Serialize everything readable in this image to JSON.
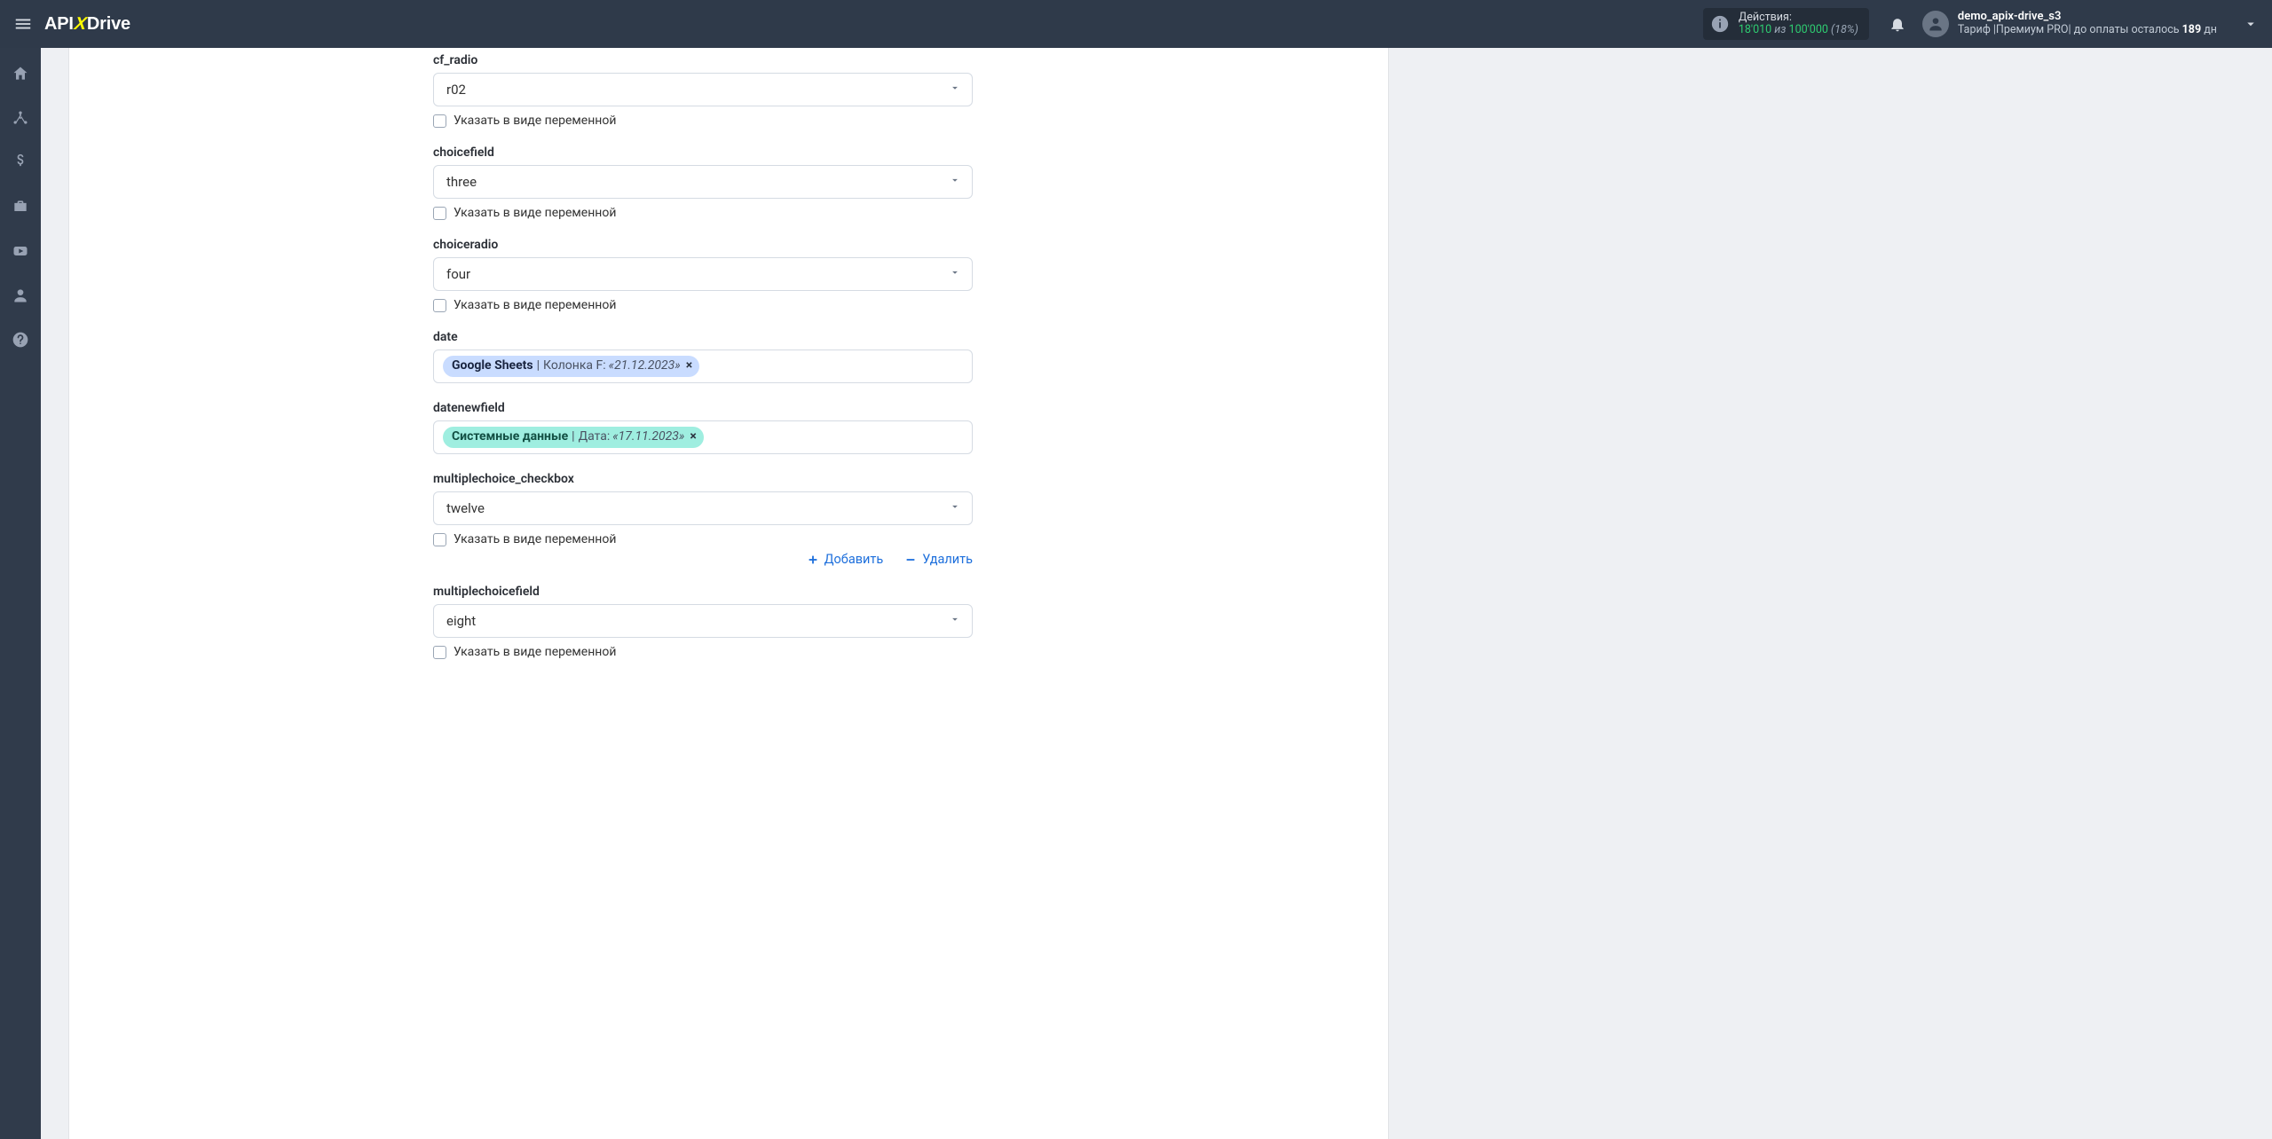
{
  "header": {
    "logo": {
      "api": "API",
      "x": "X",
      "drive": "Drive"
    },
    "actions": {
      "label": "Действия:",
      "used": "18'010",
      "iz": "из",
      "total": "100'000",
      "pct": "(18%)"
    },
    "user": {
      "name": "demo_apix-drive_s3",
      "tariff_prefix": "Тариф |Премиум PRO|  до оплаты осталось ",
      "days": "189",
      "tariff_suffix": " дн"
    }
  },
  "common": {
    "var_checkbox_label": "Указать в виде переменной",
    "add_label": "Добавить",
    "remove_label": "Удалить"
  },
  "fields": {
    "cf_radio": {
      "label": "cf_radio",
      "value": "r02"
    },
    "choicefield": {
      "label": "choicefield",
      "value": "three"
    },
    "choiceradio": {
      "label": "choiceradio",
      "value": "four"
    },
    "date": {
      "label": "date",
      "token_src": "Google Sheets",
      "token_col": " Колонка F: ",
      "token_val": "«21.12.2023»"
    },
    "datenewfield": {
      "label": "datenewfield",
      "token_src": "Системные данные",
      "token_col": " Дата: ",
      "token_val": "«17.11.2023»"
    },
    "multiplechoice_checkbox": {
      "label": "multiplechoice_checkbox",
      "value": "twelve"
    },
    "multiplechoicefield": {
      "label": "multiplechoicefield",
      "value": "eight"
    }
  }
}
